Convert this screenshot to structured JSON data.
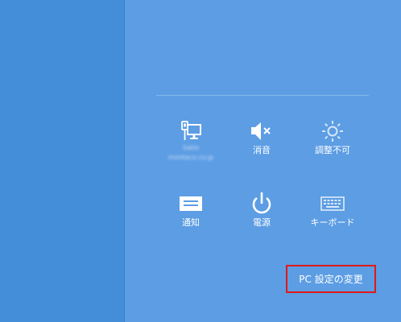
{
  "charms": {
    "tiles": [
      {
        "icon": "network-icon",
        "label": "",
        "sublabel_1": "Satio",
        "sublabel_2": "montaco.co.jp"
      },
      {
        "icon": "volume-muted-icon",
        "label": "消音"
      },
      {
        "icon": "brightness-icon",
        "label": "調整不可"
      },
      {
        "icon": "notifications-icon",
        "label": "通知"
      },
      {
        "icon": "power-icon",
        "label": "電源"
      },
      {
        "icon": "keyboard-icon",
        "label": "キーボード"
      }
    ],
    "pc_settings_label": "PC 設定の変更"
  },
  "colors": {
    "background_left": "#448ed9",
    "background_pane": "#5c9de4",
    "highlight_border": "#e11919"
  }
}
